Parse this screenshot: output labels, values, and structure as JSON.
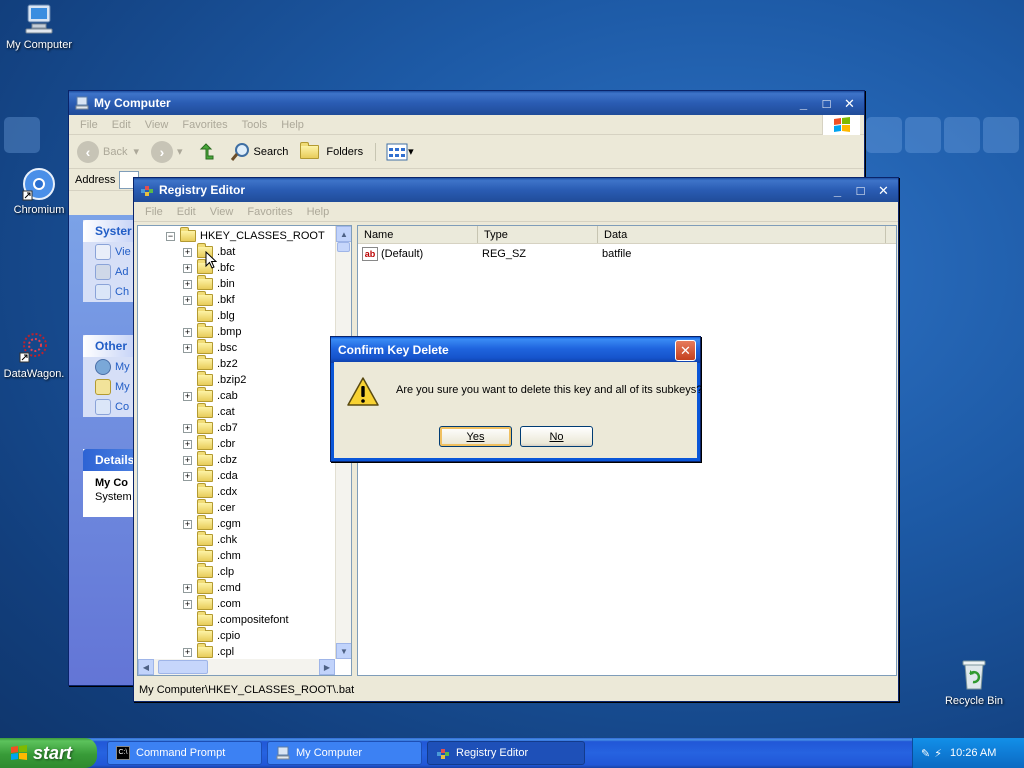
{
  "desktop": {
    "icons": [
      {
        "label": "My Computer"
      },
      {
        "label": "Chromium"
      },
      {
        "label": "DataWagon."
      },
      {
        "label": "Recycle Bin"
      }
    ]
  },
  "mycomputer": {
    "title": "My Computer",
    "menu": [
      "File",
      "Edit",
      "View",
      "Favorites",
      "Tools",
      "Help"
    ],
    "toolbar": {
      "back": "Back",
      "search": "Search",
      "folders": "Folders"
    },
    "address_label": "Address",
    "panels": [
      {
        "header": "Syster",
        "items": [
          "Vie",
          "Ad",
          "Ch"
        ]
      },
      {
        "header": "Other",
        "items": [
          "My",
          "My",
          "Co"
        ]
      },
      {
        "header": "Details",
        "items": [
          "My Co",
          "System"
        ]
      }
    ]
  },
  "regedit": {
    "title": "Registry Editor",
    "menu": [
      "File",
      "Edit",
      "View",
      "Favorites",
      "Help"
    ],
    "tree": {
      "root": "HKEY_CLASSES_ROOT",
      "items": [
        {
          "label": ".bat",
          "expandable": true
        },
        {
          "label": ".bfc",
          "expandable": true
        },
        {
          "label": ".bin",
          "expandable": true
        },
        {
          "label": ".bkf",
          "expandable": true
        },
        {
          "label": ".blg",
          "expandable": false
        },
        {
          "label": ".bmp",
          "expandable": true
        },
        {
          "label": ".bsc",
          "expandable": true
        },
        {
          "label": ".bz2",
          "expandable": false
        },
        {
          "label": ".bzip2",
          "expandable": false
        },
        {
          "label": ".cab",
          "expandable": true
        },
        {
          "label": ".cat",
          "expandable": false
        },
        {
          "label": ".cb7",
          "expandable": true
        },
        {
          "label": ".cbr",
          "expandable": true
        },
        {
          "label": ".cbz",
          "expandable": true
        },
        {
          "label": ".cda",
          "expandable": true
        },
        {
          "label": ".cdx",
          "expandable": false
        },
        {
          "label": ".cer",
          "expandable": false
        },
        {
          "label": ".cgm",
          "expandable": true
        },
        {
          "label": ".chk",
          "expandable": false
        },
        {
          "label": ".chm",
          "expandable": false
        },
        {
          "label": ".clp",
          "expandable": false
        },
        {
          "label": ".cmd",
          "expandable": true
        },
        {
          "label": ".com",
          "expandable": true
        },
        {
          "label": ".compositefont",
          "expandable": false
        },
        {
          "label": ".cpio",
          "expandable": false
        },
        {
          "label": ".cpl",
          "expandable": true
        }
      ]
    },
    "columns": [
      "Name",
      "Type",
      "Data"
    ],
    "values": [
      {
        "name": "(Default)",
        "type": "REG_SZ",
        "data": "batfile"
      }
    ],
    "status": "My Computer\\HKEY_CLASSES_ROOT\\.bat"
  },
  "dialog": {
    "title": "Confirm Key Delete",
    "message": "Are you sure you want to delete this key and all of its subkeys?",
    "yes_label": "Yes",
    "no_label": "No"
  },
  "taskbar": {
    "start_label": "start",
    "tasks": [
      {
        "label": "Command Prompt",
        "active": false
      },
      {
        "label": "My Computer",
        "active": false
      },
      {
        "label": "Registry Editor",
        "active": true
      }
    ],
    "clock": "10:26 AM"
  },
  "colors": {
    "title_active": "#1f64de",
    "start_green": "#389b38",
    "desktop_blue": "#1d5aa6"
  }
}
